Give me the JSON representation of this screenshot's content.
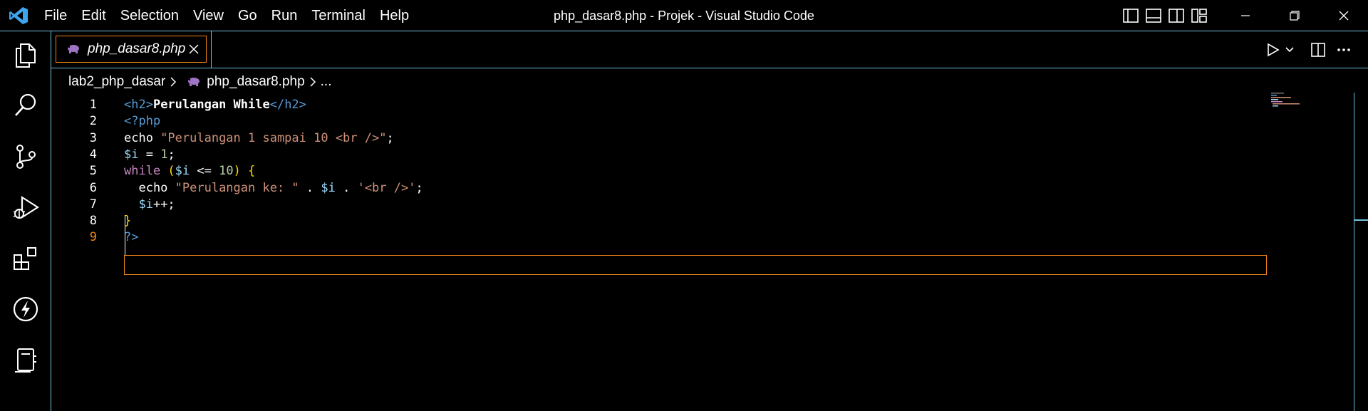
{
  "menu": [
    "File",
    "Edit",
    "Selection",
    "View",
    "Go",
    "Run",
    "Terminal",
    "Help"
  ],
  "window_title": "php_dasar8.php - Projek - Visual Studio Code",
  "tab": {
    "label": "php_dasar8.php"
  },
  "breadcrumb": {
    "folder": "lab2_php_dasar",
    "file": "php_dasar8.php",
    "more": "..."
  },
  "colors": {
    "accent_border": "#6fc3df",
    "active_border": "#f38518",
    "vscode_blue": "#3ea6f0",
    "php_purple": "#a074c4"
  },
  "icons": {
    "activity": [
      "explorer-icon",
      "search-icon",
      "source-control-icon",
      "run-debug-icon",
      "extensions-icon",
      "lightning-icon",
      "notebook-icon"
    ],
    "title_controls": [
      "toggle-primary-sidebar-icon",
      "toggle-panel-icon",
      "toggle-secondary-sidebar-icon",
      "customize-layout-icon"
    ],
    "editor_actions": [
      "run-icon",
      "chevron-down-icon",
      "split-editor-icon",
      "more-actions-icon"
    ]
  },
  "editor": {
    "current_line": 9,
    "lines": [
      {
        "n": "1",
        "tokens": [
          [
            "<h2>",
            "c-tag"
          ],
          [
            "Perulangan While",
            "c-text"
          ],
          [
            "</h2>",
            "c-tag"
          ]
        ]
      },
      {
        "n": "2",
        "tokens": [
          [
            "<?php",
            "c-tag"
          ]
        ]
      },
      {
        "n": "3",
        "tokens": [
          [
            "echo ",
            "c-plain"
          ],
          [
            "\"Perulangan 1 sampai 10 <br />\"",
            "c-str"
          ],
          [
            ";",
            "c-plain"
          ]
        ]
      },
      {
        "n": "4",
        "tokens": [
          [
            "$i",
            "c-var"
          ],
          [
            " = ",
            "c-plain"
          ],
          [
            "1",
            "c-num"
          ],
          [
            ";",
            "c-plain"
          ]
        ]
      },
      {
        "n": "5",
        "tokens": [
          [
            "while ",
            "c-kw"
          ],
          [
            "(",
            "c-brace"
          ],
          [
            "$i",
            "c-var"
          ],
          [
            " <= ",
            "c-plain"
          ],
          [
            "10",
            "c-num"
          ],
          [
            ") ",
            "c-brace"
          ],
          [
            "{",
            "c-brace"
          ]
        ]
      },
      {
        "n": "6",
        "tokens": [
          [
            "  echo ",
            "c-plain"
          ],
          [
            "\"Perulangan ke: \"",
            "c-str"
          ],
          [
            " . ",
            "c-plain"
          ],
          [
            "$i",
            "c-var"
          ],
          [
            " . ",
            "c-plain"
          ],
          [
            "'<br />'",
            "c-str"
          ],
          [
            ";",
            "c-plain"
          ]
        ]
      },
      {
        "n": "7",
        "tokens": [
          [
            "  $i",
            "c-var"
          ],
          [
            "++;",
            "c-plain"
          ]
        ]
      },
      {
        "n": "8",
        "tokens": [
          [
            "}",
            "c-brace"
          ]
        ]
      },
      {
        "n": "9",
        "tokens": [
          [
            "?>",
            "c-tag"
          ]
        ]
      }
    ]
  }
}
